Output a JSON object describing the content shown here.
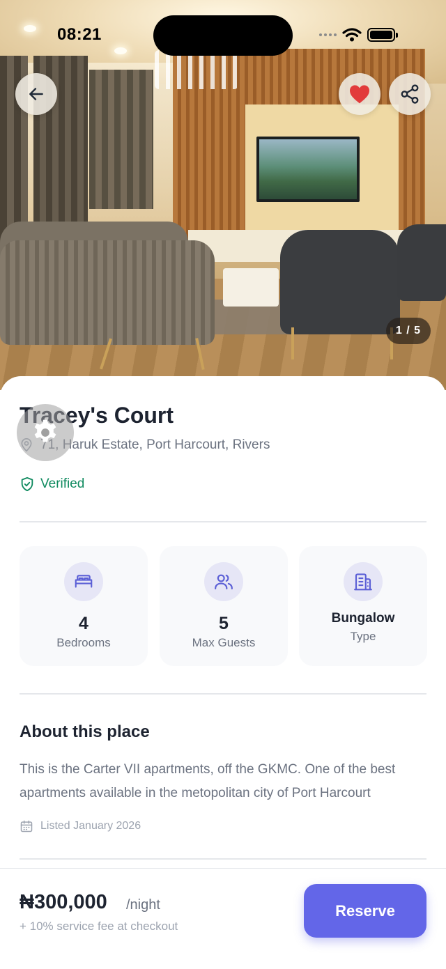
{
  "status_bar": {
    "time": "08:21"
  },
  "hero": {
    "image_counter": "1 / 5"
  },
  "listing": {
    "title": "Tracey's Court",
    "address": "71, Haruk Estate, Port Harcourt, Rivers",
    "verified_label": "Verified"
  },
  "stats": [
    {
      "value": "4",
      "label": "Bedrooms",
      "icon": "bed-icon"
    },
    {
      "value": "5",
      "label": "Max Guests",
      "icon": "users-icon"
    },
    {
      "value": "Bungalow",
      "label": "Type",
      "icon": "building-icon"
    }
  ],
  "about": {
    "heading": "About this place",
    "description": "This is the Carter VII apartments, off the GKMC. One of the best apartments available in the metopolitan city of Port Harcourt",
    "listed": "Listed January 2026"
  },
  "booking": {
    "price": "₦300,000",
    "unit": "/night",
    "fee_note": "+ 10% service fee at checkout",
    "reserve_label": "Reserve"
  },
  "colors": {
    "accent": "#6366e8",
    "verified": "#0f8a5f",
    "heart": "#e23b3b",
    "text_primary": "#1d2330",
    "text_secondary": "#6b7280"
  }
}
